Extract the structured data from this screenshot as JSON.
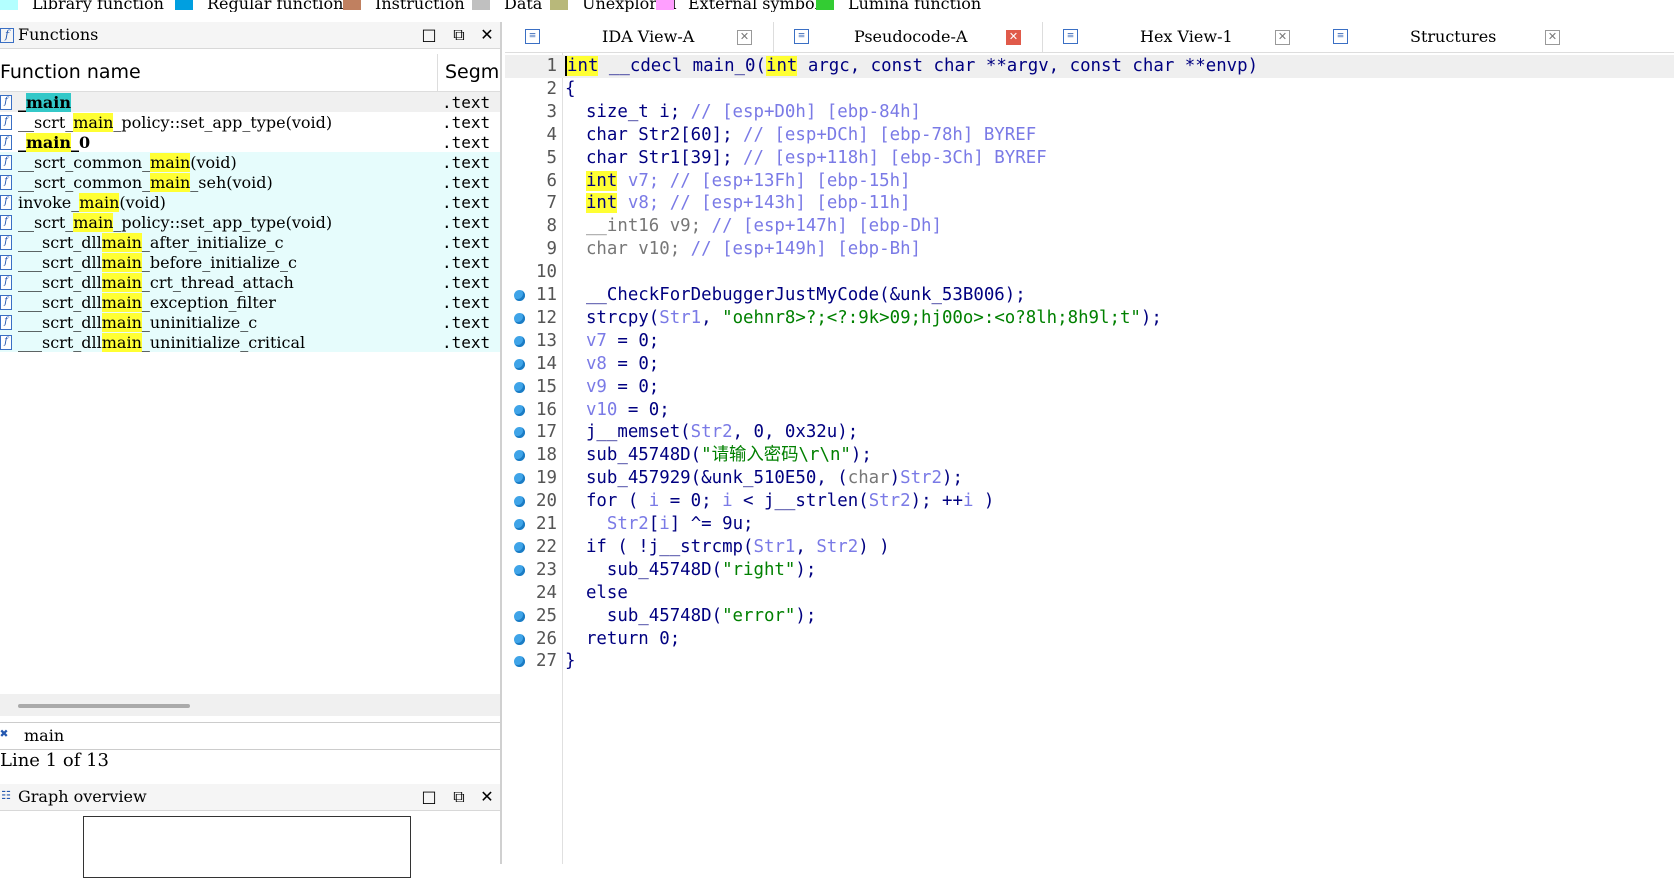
{
  "legend": [
    {
      "label": "Library function",
      "color": "#b3ffff"
    },
    {
      "label": "Regular function",
      "color": "#009fe0"
    },
    {
      "label": "Instruction",
      "color": "#c08060"
    },
    {
      "label": "Data",
      "color": "#c0c0c0"
    },
    {
      "label": "Unexplored",
      "color": "#b8b87a"
    },
    {
      "label": "External symbol",
      "color": "#ff9fff"
    },
    {
      "label": "Lumina function",
      "color": "#33cc33"
    }
  ],
  "functions_panel": {
    "title": "Functions",
    "col_name": "Function name",
    "col_segment": "Segment",
    "rows": [
      {
        "pre": "_",
        "hl": "main",
        "post": "",
        "seg": ".text",
        "bold": true,
        "bg": "#f0f0f0",
        "hlclass": "hl2"
      },
      {
        "pre": "__scrt_",
        "hl": "main",
        "post": "_policy::set_app_type(void)",
        "seg": ".text",
        "bold": false,
        "bg": "#ffffff",
        "hlclass": "hl"
      },
      {
        "pre": "_",
        "hl": "main",
        "post": "_0",
        "seg": ".text",
        "bold": true,
        "bg": "#ffffff",
        "hlclass": "hl"
      },
      {
        "pre": "__scrt_common_",
        "hl": "main",
        "post": "(void)",
        "seg": ".text",
        "bold": false,
        "bg": "#e6fcfc",
        "hlclass": "hl"
      },
      {
        "pre": "__scrt_common_",
        "hl": "main",
        "post": "_seh(void)",
        "seg": ".text",
        "bold": false,
        "bg": "#e6fcfc",
        "hlclass": "hl"
      },
      {
        "pre": "invoke_",
        "hl": "main",
        "post": "(void)",
        "seg": ".text",
        "bold": false,
        "bg": "#e6fcfc",
        "hlclass": "hl"
      },
      {
        "pre": "__scrt_",
        "hl": "main",
        "post": "_policy::set_app_type(void)",
        "seg": ".text",
        "bold": false,
        "bg": "#e6fcfc",
        "hlclass": "hl"
      },
      {
        "pre": "___scrt_dll",
        "hl": "main",
        "post": "_after_initialize_c",
        "seg": ".text",
        "bold": false,
        "bg": "#e6fcfc",
        "hlclass": "hl"
      },
      {
        "pre": "___scrt_dll",
        "hl": "main",
        "post": "_before_initialize_c",
        "seg": ".text",
        "bold": false,
        "bg": "#e6fcfc",
        "hlclass": "hl"
      },
      {
        "pre": "___scrt_dll",
        "hl": "main",
        "post": "_crt_thread_attach",
        "seg": ".text",
        "bold": false,
        "bg": "#e6fcfc",
        "hlclass": "hl"
      },
      {
        "pre": "___scrt_dll",
        "hl": "main",
        "post": "_exception_filter",
        "seg": ".text",
        "bold": false,
        "bg": "#e6fcfc",
        "hlclass": "hl"
      },
      {
        "pre": "___scrt_dll",
        "hl": "main",
        "post": "_uninitialize_c",
        "seg": ".text",
        "bold": false,
        "bg": "#e6fcfc",
        "hlclass": "hl"
      },
      {
        "pre": "___scrt_dll",
        "hl": "main",
        "post": "_uninitialize_critical",
        "seg": ".text",
        "bold": false,
        "bg": "#e6fcfc",
        "hlclass": "hl"
      }
    ],
    "filter_value": "main",
    "line_count": "Line 1 of 13"
  },
  "graph_panel": {
    "title": "Graph overview"
  },
  "tabs": [
    {
      "label": "IDA View-A",
      "icon": "ida-view-icon",
      "active": false
    },
    {
      "label": "Pseudocode-A",
      "icon": "pseudocode-icon",
      "active": true
    },
    {
      "label": "Hex View-1",
      "icon": "hex-view-icon",
      "active": false
    },
    {
      "label": "Structures",
      "icon": "structures-icon",
      "active": false
    }
  ],
  "code_lines": [
    {
      "n": "1",
      "dot": false,
      "html": "<span class='cursor'></span><span class='ywl'>int</span> <span class='kw'>__cdecl main_0(</span><span class='ywl'>int</span><span class='kw'> argc, const char **argv, const char **envp)</span>"
    },
    {
      "n": "2",
      "dot": false,
      "html": "<span class='kw'>{</span>"
    },
    {
      "n": "3",
      "dot": false,
      "html": "  <span class='kw'>size_t i;</span> <span class='cmt'>// [esp+D0h] [ebp-84h]</span>"
    },
    {
      "n": "4",
      "dot": false,
      "html": "  <span class='kw'>char Str2[60];</span> <span class='cmt'>// [esp+DCh] [ebp-78h] BYREF</span>"
    },
    {
      "n": "5",
      "dot": false,
      "html": "  <span class='kw'>char Str1[39];</span> <span class='cmt'>// [esp+118h] [ebp-3Ch] BYREF</span>"
    },
    {
      "n": "6",
      "dot": false,
      "html": "  <span class='ywl'>int</span> <span class='var'>v7;</span> <span class='cmt'>// [esp+13Fh] [ebp-15h]</span>"
    },
    {
      "n": "7",
      "dot": false,
      "html": "  <span class='ywl'>int</span> <span class='var'>v8;</span> <span class='cmt'>// [esp+143h] [ebp-11h]</span>"
    },
    {
      "n": "8",
      "dot": false,
      "html": "  <span class='grey'>__int16 v9;</span> <span class='cmt'>// [esp+147h] [ebp-Dh]</span>"
    },
    {
      "n": "9",
      "dot": false,
      "html": "  <span class='grey'>char v10;</span> <span class='cmt'>// [esp+149h] [ebp-Bh]</span>"
    },
    {
      "n": "10",
      "dot": false,
      "html": ""
    },
    {
      "n": "11",
      "dot": true,
      "html": "  <span class='kw'>__CheckForDebuggerJustMyCode(&amp;unk_53B006);</span>"
    },
    {
      "n": "12",
      "dot": true,
      "html": "  <span class='kw'>strcpy(</span><span class='var'>Str1</span><span class='kw'>, </span><span class='str'>\"oehnr8&gt;?;&lt;?:9k&gt;09;hj00o&gt;:&lt;o?8lh;8h9l;t\"</span><span class='kw'>);</span>"
    },
    {
      "n": "13",
      "dot": true,
      "html": "  <span class='var'>v7</span><span class='kw'> = 0;</span>"
    },
    {
      "n": "14",
      "dot": true,
      "html": "  <span class='var'>v8</span><span class='kw'> = 0;</span>"
    },
    {
      "n": "15",
      "dot": true,
      "html": "  <span class='var'>v9</span><span class='kw'> = 0;</span>"
    },
    {
      "n": "16",
      "dot": true,
      "html": "  <span class='var'>v10</span><span class='kw'> = 0;</span>"
    },
    {
      "n": "17",
      "dot": true,
      "html": "  <span class='kw'>j__memset(</span><span class='var'>Str2</span><span class='kw'>, 0, 0x32u);</span>"
    },
    {
      "n": "18",
      "dot": true,
      "html": "  <span class='kw'>sub_45748D(</span><span class='str'>\"请输入密码\\r\\n\"</span><span class='kw'>);</span>"
    },
    {
      "n": "19",
      "dot": true,
      "html": "  <span class='kw'>sub_457929(&amp;unk_510E50, (</span><span class='grey'>char</span><span class='kw'>)</span><span class='var'>Str2</span><span class='kw'>);</span>"
    },
    {
      "n": "20",
      "dot": true,
      "html": "  <span class='kw'>for ( </span><span class='var'>i</span><span class='kw'> = 0; </span><span class='var'>i</span><span class='kw'> &lt; j__strlen(</span><span class='var'>Str2</span><span class='kw'>); ++</span><span class='var'>i</span><span class='kw'> )</span>"
    },
    {
      "n": "21",
      "dot": true,
      "html": "    <span class='var'>Str2</span><span class='kw'>[</span><span class='var'>i</span><span class='kw'>] ^= 9u;</span>"
    },
    {
      "n": "22",
      "dot": true,
      "html": "  <span class='kw'>if ( !j__strcmp(</span><span class='var'>Str1</span><span class='kw'>, </span><span class='var'>Str2</span><span class='kw'>) )</span>"
    },
    {
      "n": "23",
      "dot": true,
      "html": "    <span class='kw'>sub_45748D(</span><span class='str'>\"right\"</span><span class='kw'>);</span>"
    },
    {
      "n": "24",
      "dot": false,
      "html": "  <span class='kw'>else</span>"
    },
    {
      "n": "25",
      "dot": true,
      "html": "    <span class='kw'>sub_45748D(</span><span class='str'>\"error\"</span><span class='kw'>);</span>"
    },
    {
      "n": "26",
      "dot": true,
      "html": "  <span class='kw'>return 0;</span>"
    },
    {
      "n": "27",
      "dot": true,
      "html": "<span class='kw'>}</span>"
    }
  ]
}
